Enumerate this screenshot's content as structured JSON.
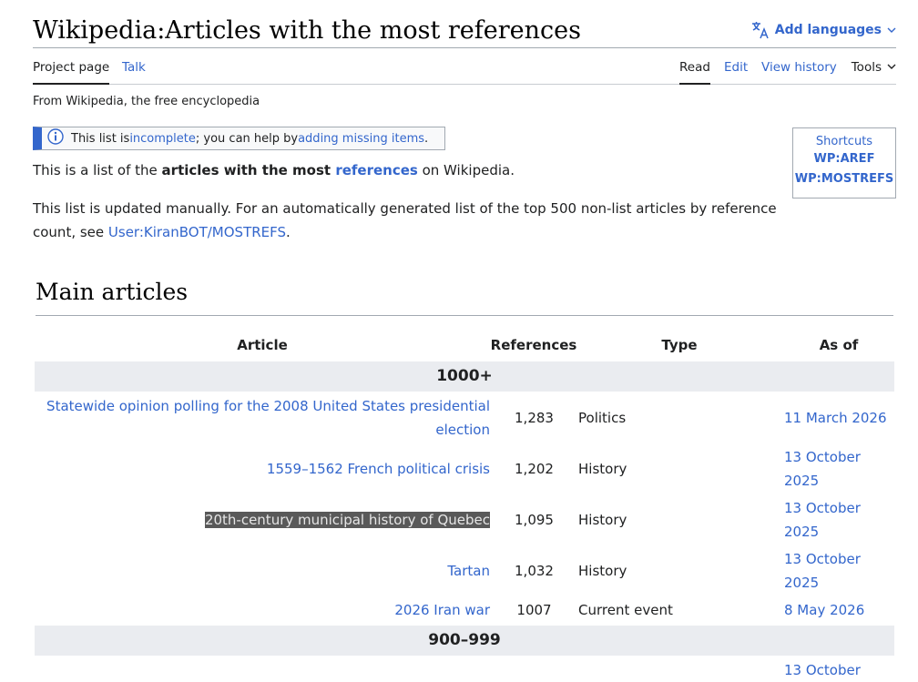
{
  "header": {
    "title_prefix": "Wikipedia",
    "title_sep": ":",
    "title_main": "Articles with the most references",
    "add_languages": "Add languages"
  },
  "tabs": {
    "left": [
      "Project page",
      "Talk"
    ],
    "right": [
      "Read",
      "Edit",
      "View history"
    ],
    "tools": "Tools"
  },
  "tagline": "From Wikipedia, the free encyclopedia",
  "notice": {
    "pre": "This list is ",
    "link1": "incomplete",
    "mid": "; you can help by ",
    "link2": "adding missing items",
    "post": "."
  },
  "intro": {
    "p1_pre": "This is a list of the ",
    "p1_bold": "articles with the most ",
    "p1_link": "references",
    "p1_post": " on Wikipedia.",
    "p2_pre": "This list is updated manually. For an automatically generated list of the top 500 non-list articles by reference count, see ",
    "p2_link": "User:KiranBOT/MOSTREFS",
    "p2_post": "."
  },
  "shortcuts": {
    "title": "Shortcuts",
    "items": [
      "WP:AREF",
      "WP:MOSTREFS"
    ]
  },
  "section": {
    "heading": "Main articles"
  },
  "table": {
    "headers": [
      "Article",
      "References",
      "Type",
      "As of"
    ],
    "groups": [
      {
        "label": "1000+",
        "rows": [
          {
            "article": "Statewide opinion polling for the 2008 United States presidential election",
            "refs": "1,283",
            "type": "Politics",
            "asof": "11 March 2026"
          },
          {
            "article": "1559–1562 French political crisis",
            "refs": "1,202",
            "type": "History",
            "asof": "13 October 2025"
          },
          {
            "article": "20th-century municipal history of Quebec",
            "refs": "1,095",
            "type": "History",
            "asof": "13 October 2025"
          },
          {
            "article": "Tartan",
            "refs": "1,032",
            "type": "History",
            "asof": "13 October 2025"
          },
          {
            "article": "2026 Iran war",
            "refs": "1007",
            "type": "Current event",
            "asof": "8 May 2026"
          }
        ]
      },
      {
        "label": "900–999",
        "rows": [
          {
            "article": "",
            "refs": "",
            "type": "",
            "asof": "13 October"
          }
        ]
      }
    ]
  }
}
